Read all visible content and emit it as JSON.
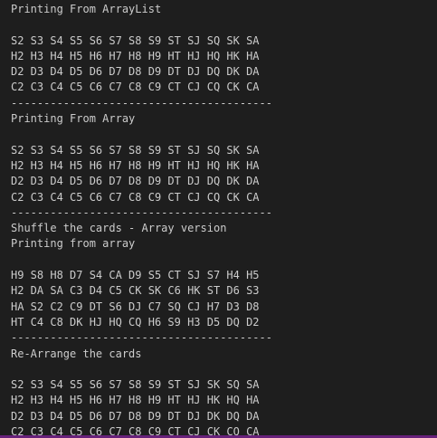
{
  "terminal": {
    "clipped_top_text": "",
    "lines": [
      "Printing From ArrayList",
      "",
      "S2 S3 S4 S5 S6 S7 S8 S9 ST SJ SQ SK SA",
      "H2 H3 H4 H5 H6 H7 H8 H9 HT HJ HQ HK HA",
      "D2 D3 D4 D5 D6 D7 D8 D9 DT DJ DQ DK DA",
      "C2 C3 C4 C5 C6 C7 C8 C9 CT CJ CQ CK CA",
      "----------------------------------------",
      "Printing From Array",
      "",
      "S2 S3 S4 S5 S6 S7 S8 S9 ST SJ SQ SK SA",
      "H2 H3 H4 H5 H6 H7 H8 H9 HT HJ HQ HK HA",
      "D2 D3 D4 D5 D6 D7 D8 D9 DT DJ DQ DK DA",
      "C2 C3 C4 C5 C6 C7 C8 C9 CT CJ CQ CK CA",
      "----------------------------------------",
      "Shuffle the cards - Array version",
      "Printing from array",
      "",
      "H9 S8 H8 D7 S4 CA D9 S5 CT SJ S7 H4 H5",
      "H2 DA SA C3 D4 C5 CK SK C6 HK ST D6 S3",
      "HA S2 C2 C9 DT S6 DJ C7 SQ CJ H7 D3 D8",
      "HT C4 C8 DK HJ HQ CQ H6 S9 H3 D5 DQ D2",
      "----------------------------------------",
      "Re-Arrange the cards",
      "",
      "S2 S3 S4 S5 S6 S7 S8 S9 ST SJ SK SQ SA",
      "H2 H3 H4 H5 H6 H7 H8 H9 HT HJ HK HQ HA",
      "D2 D3 D4 D5 D6 D7 D8 D9 DT DJ DK DQ DA",
      "C2 C3 C4 C5 C6 C7 C8 C9 CT CJ CK CQ CA"
    ]
  },
  "colors": {
    "background": "#1e1e1e",
    "text": "#cccccc",
    "status_strip": "#68217a"
  }
}
